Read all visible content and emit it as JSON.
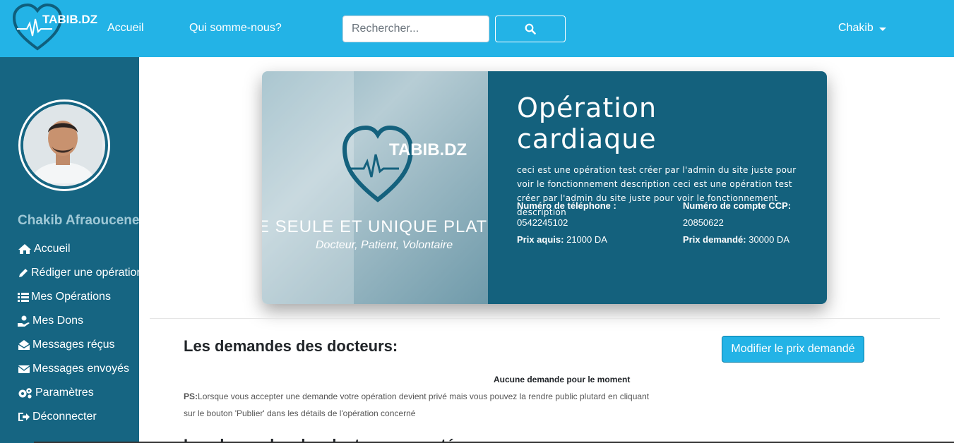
{
  "navbar": {
    "logo_text": "TABIB.DZ",
    "links": [
      "Accueil",
      "Qui somme-nous?"
    ],
    "search": {
      "placeholder": "Rechercher...",
      "value": ""
    },
    "search_icon": "search-icon",
    "user": "Chakib"
  },
  "sidebar": {
    "profile_name": "Chakib Afraoucene",
    "items": [
      {
        "label": "Accueil",
        "icon": "home-icon"
      },
      {
        "label": "Rédiger une opération",
        "icon": "pen-icon"
      },
      {
        "label": "Mes Opérations",
        "icon": "list-icon"
      },
      {
        "label": "Mes Dons",
        "icon": "donate-icon"
      },
      {
        "label": "Messages réçus",
        "icon": "envelope-open-icon"
      },
      {
        "label": "Messages envoyés",
        "icon": "envelope-icon"
      },
      {
        "label": "Paramètres",
        "icon": "cogs-icon"
      },
      {
        "label": "Déconnecter",
        "icon": "sign-out-icon"
      }
    ]
  },
  "card": {
    "image": {
      "logo_text": "TABIB.DZ",
      "slogan": "E SEULE ET UNIQUE PLATFO",
      "subtitle": "Docteur, Patient, Volontaire"
    },
    "title": "Opération cardiaque",
    "description": "ceci est une opération test créer par l'admin du site juste pour voir le fonctionnement description ceci est une opération test créer par l'admin du site juste pour voir le fonctionnement description",
    "phone_label": "Numéro de téléphone :",
    "phone_value": "0542245102",
    "ccp_label": "Numéro de compte CCP:",
    "ccp_value": "20850622",
    "prix_aquis_label": "Prix aquis:",
    "prix_aquis_value": "21000 DA",
    "prix_demande_label": "Prix demandé:",
    "prix_demande_value": "30000 DA"
  },
  "requests": {
    "title": "Les demandes des docteurs:",
    "modify_button": "Modifier le prix demandé",
    "empty_text": "Aucune demande pour le moment",
    "ps_label": "PS:",
    "ps_text": "Lorsque vous accepter une demande votre opération devient privé mais vous pouvez la rendre public plutard en cliquant sur le bouton 'Publier' dans les détails de l'opération concerné"
  },
  "next_section_title": "Les demandes des docteurs acceptées"
}
